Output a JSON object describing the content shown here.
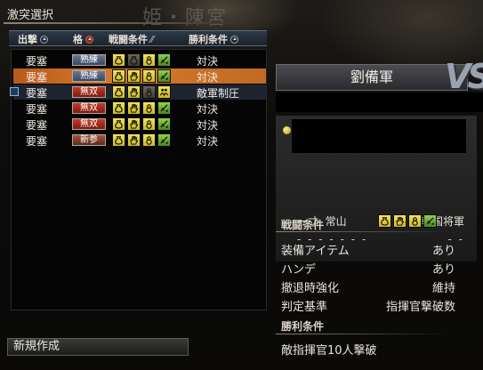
{
  "window": {
    "title": "激突選択",
    "background_title": "姫・陳宮"
  },
  "headers": {
    "sortie": "出撃",
    "rank": "格",
    "battle_cond": "戦闘条件",
    "victory_cond": "勝利条件"
  },
  "rows": [
    {
      "type": "要塞",
      "rank": "熟練",
      "rank_style": "jukuren",
      "icons": [
        "pouch",
        "pouch-dim",
        "gourd",
        "sword"
      ],
      "victory": "対決",
      "state": "normal"
    },
    {
      "type": "要塞",
      "rank": "熟練",
      "rank_style": "jukuren",
      "icons": [
        "pouch",
        "hand",
        "gourd",
        "sword"
      ],
      "victory": "対決",
      "state": "selected"
    },
    {
      "type": "要塞",
      "rank": "無双",
      "rank_style": "musou",
      "icons": [
        "pouch",
        "hand",
        "gourd-dim",
        "people"
      ],
      "victory": "敵軍制圧",
      "state": "highlight"
    },
    {
      "type": "要塞",
      "rank": "無双",
      "rank_style": "musou",
      "icons": [
        "pouch",
        "hand",
        "gourd",
        "sword"
      ],
      "victory": "対決",
      "state": "normal"
    },
    {
      "type": "要塞",
      "rank": "無双",
      "rank_style": "musou",
      "icons": [
        "pouch",
        "hand",
        "gourd",
        "sword"
      ],
      "victory": "対決",
      "state": "normal"
    },
    {
      "type": "要塞",
      "rank": "新参",
      "rank_style": "shinsan",
      "icons": [
        "pouch",
        "hand",
        "gourd",
        "sword"
      ],
      "victory": "対決",
      "state": "normal"
    }
  ],
  "new_button": "新規作成",
  "army": {
    "name": "劉備軍",
    "vs_text": "VS"
  },
  "general": {
    "title_left": "一寸. 常山",
    "title_right": "輔国将軍",
    "dashes_left": "- - - - - - -",
    "dashes_right": "- -"
  },
  "battle_conditions": {
    "title": "戦闘条件",
    "icons": [
      "pouch",
      "hand",
      "gourd",
      "sword"
    ],
    "items": [
      {
        "key": "装備アイテム",
        "value": "あり"
      },
      {
        "key": "ハンデ",
        "value": "あり"
      },
      {
        "key": "撤退時強化",
        "value": "維持"
      },
      {
        "key": "判定基準",
        "value": "指揮官撃破数"
      }
    ]
  },
  "victory_conditions": {
    "title": "勝利条件",
    "text": "敵指揮官10人撃破"
  },
  "colors": {
    "selected_row": "#d67a2c",
    "accent_yellow": "#f0e460",
    "accent_green": "#8ed050"
  }
}
